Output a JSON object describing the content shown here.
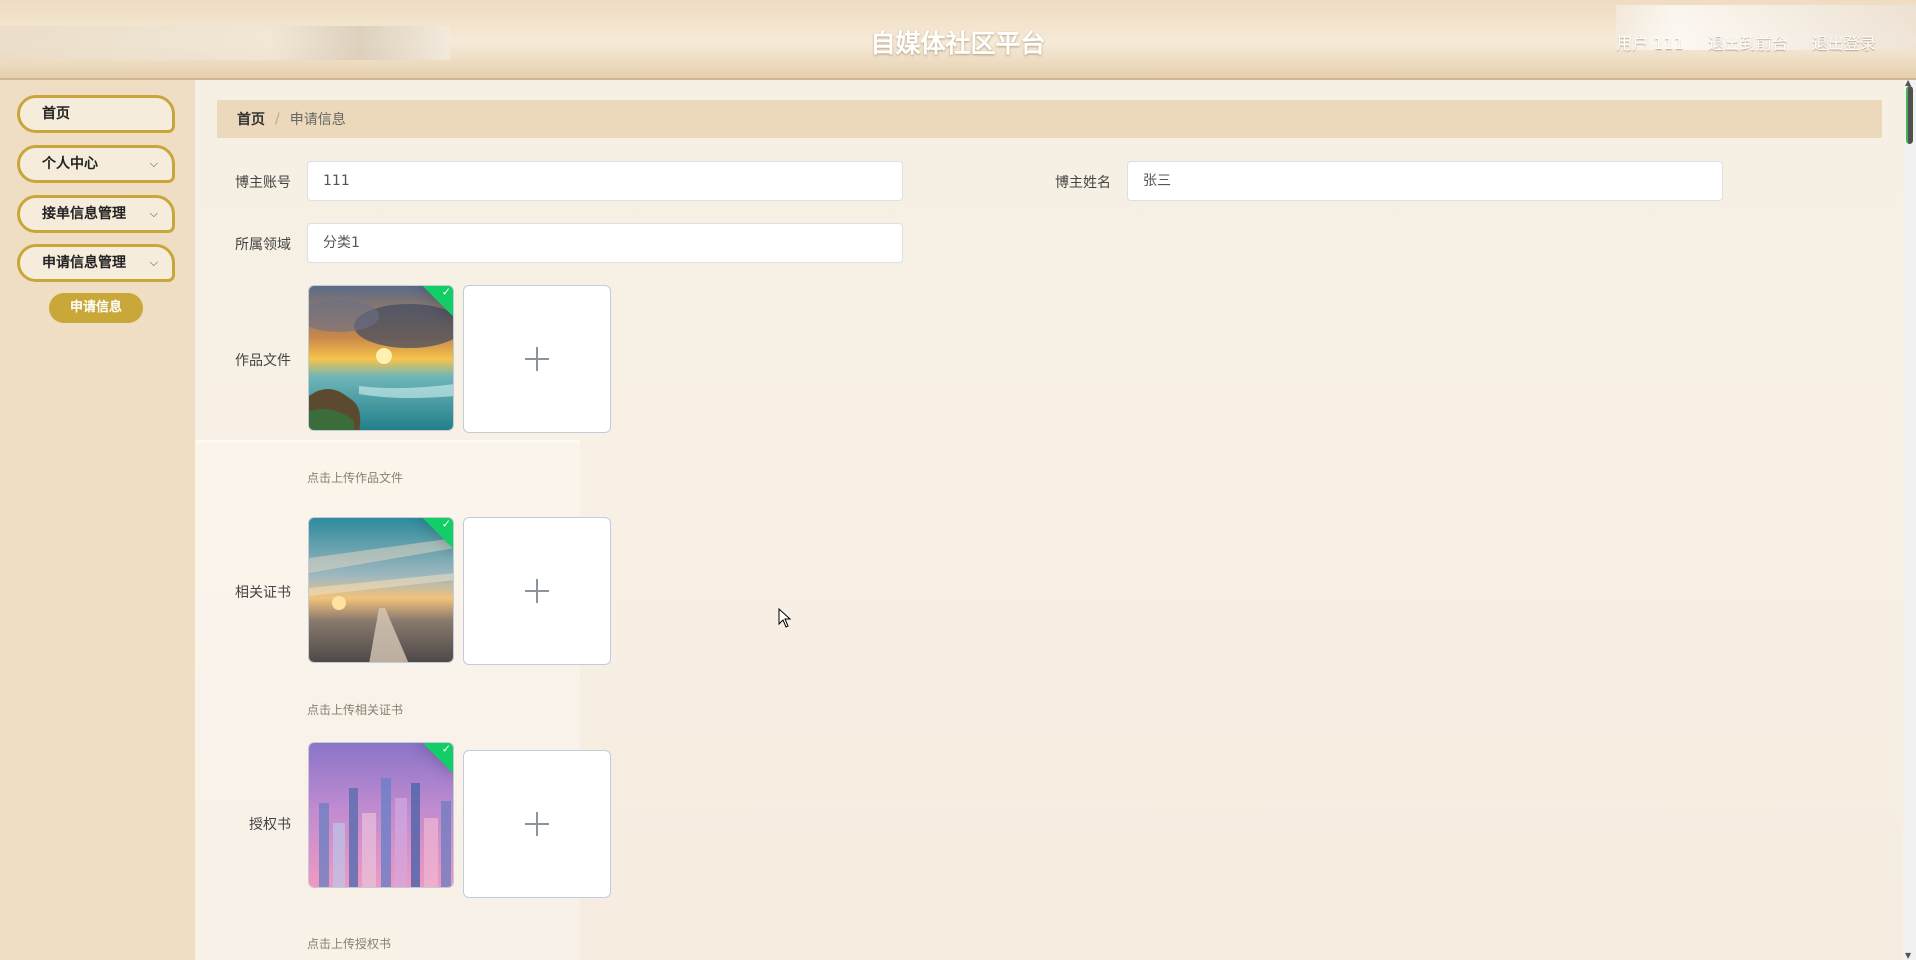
{
  "header": {
    "title": "自媒体社区平台",
    "user_label": "用户 111",
    "frontend_link": "退出到前台",
    "logout_link": "退出登录"
  },
  "sidebar": {
    "items": [
      {
        "label": "首页",
        "has_chevron": false
      },
      {
        "label": "个人中心",
        "has_chevron": true
      },
      {
        "label": "接单信息管理",
        "has_chevron": true
      },
      {
        "label": "申请信息管理",
        "has_chevron": true
      }
    ],
    "active_sub_item": "申请信息",
    "chevron": "⌵"
  },
  "breadcrumb": {
    "home": "首页",
    "separator": "/",
    "current": "申请信息"
  },
  "form": {
    "blogger_account": {
      "label": "博主账号",
      "value": "111"
    },
    "blogger_name": {
      "label": "博主姓名",
      "value": "张三"
    },
    "field": {
      "label": "所属领域",
      "value": "分类1"
    },
    "work_file": {
      "label": "作品文件",
      "tip": "点击上传作品文件"
    },
    "certificate": {
      "label": "相关证书",
      "tip": "点击上传相关证书"
    },
    "authorization": {
      "label": "授权书",
      "tip": "点击上传授权书"
    }
  },
  "colors": {
    "accent": "#c9a738",
    "success_badge": "#13ce66",
    "breadcrumb_bg": "#ecd9bb"
  }
}
